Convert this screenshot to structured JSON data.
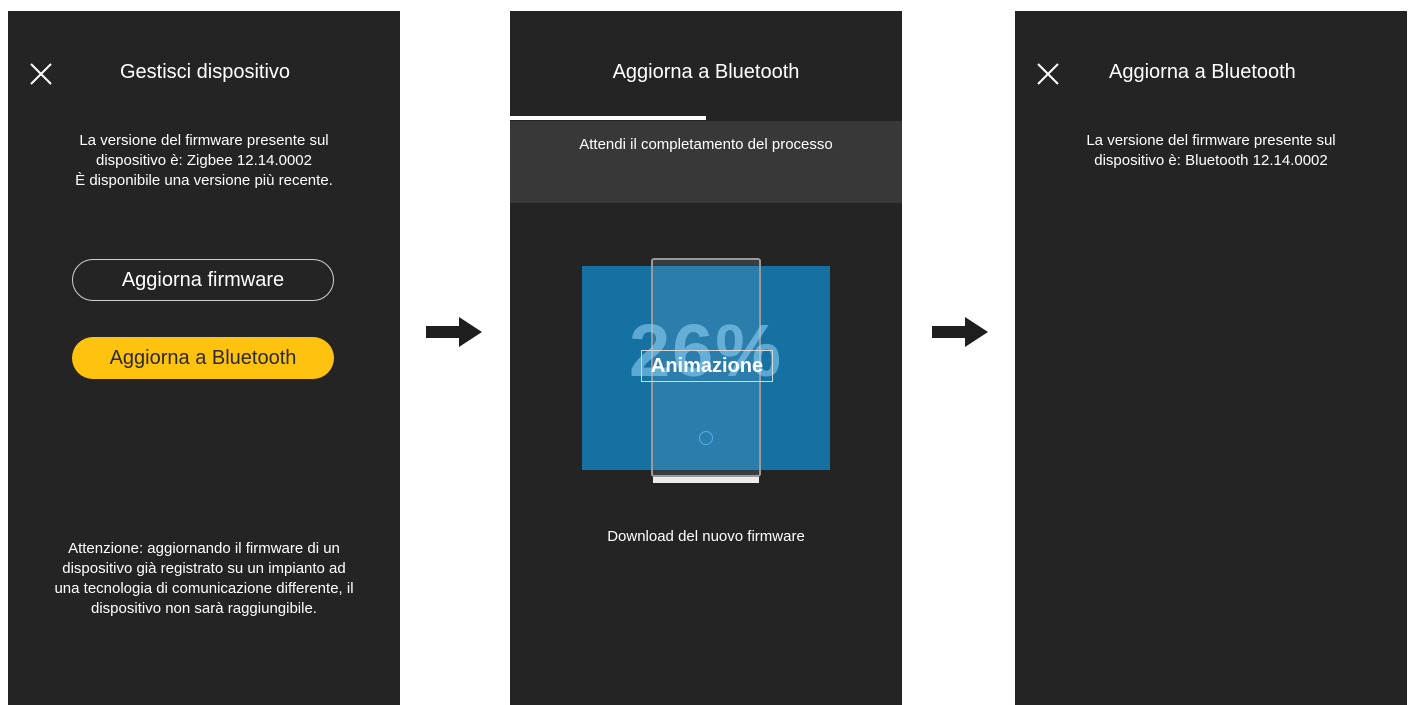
{
  "screen1": {
    "title": "Gestisci dispositivo",
    "close_icon": "close-icon",
    "info_lines": [
      "La versione del firmware presente sul",
      "dispositivo è: Zigbee 12.14.0002",
      "È disponibile una versione più recente."
    ],
    "update_firmware_label": "Aggiorna firmware",
    "update_bluetooth_label": "Aggiorna a Bluetooth",
    "warning_lines": [
      "Attenzione: aggiornando il firmware di un",
      "dispositivo già registrato su un impianto ad",
      "una tecnologia di comunicazione differente, il",
      "dispositivo non sarà raggiungibile."
    ]
  },
  "screen2": {
    "title": "Aggiorna a Bluetooth",
    "progress": 0.5,
    "wait_text": "Attendi il completamento del processo",
    "percent": "26%",
    "animation_label": "Animazione",
    "status_text": "Download del nuovo firmware"
  },
  "screen3": {
    "title": "Aggiorna a Bluetooth",
    "close_icon": "close-icon",
    "info_lines": [
      "La versione del firmware presente sul",
      "dispositivo è: Bluetooth 12.14.0002"
    ]
  },
  "arrows": [
    "arrow-right-icon",
    "arrow-right-icon"
  ],
  "colors": {
    "screen_bg": "#242424",
    "band_bg": "#383838",
    "accent_yellow": "#ffc20e",
    "animation_blue": "#1671a3"
  }
}
